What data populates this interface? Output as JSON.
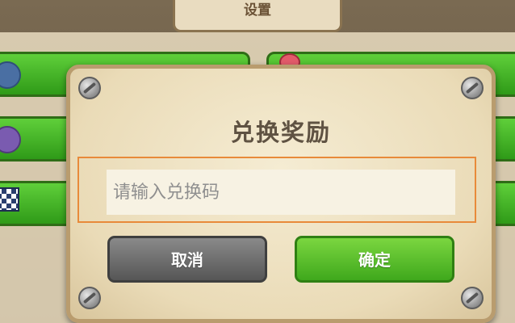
{
  "background": {
    "tab_title": "设置"
  },
  "dialog": {
    "title": "兑换奖励",
    "input_placeholder": "请输入兑换码",
    "input_value": "",
    "cancel_label": "取消",
    "confirm_label": "确定"
  },
  "colors": {
    "confirm": "#4cbb20",
    "cancel": "#6e6e6e",
    "highlight_frame": "#e88a3a",
    "dialog_bg": "#eadbb7"
  }
}
